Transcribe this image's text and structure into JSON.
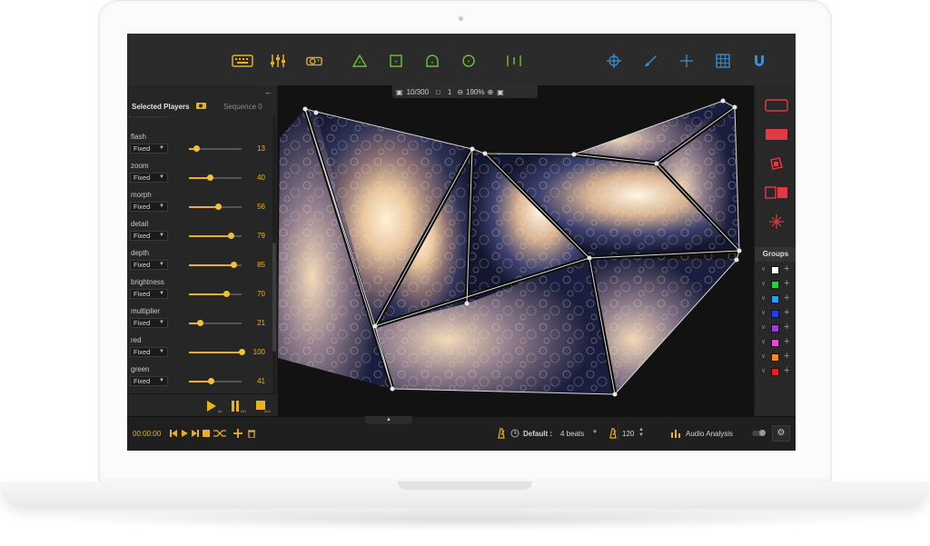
{
  "left_panel": {
    "title": "Selected Players",
    "sequence": "Sequence 0",
    "params": [
      {
        "name": "flash",
        "mode": "Fixed",
        "value": 13
      },
      {
        "name": "zoom",
        "mode": "Fixed",
        "value": 40
      },
      {
        "name": "morph",
        "mode": "Fixed",
        "value": 56
      },
      {
        "name": "detail",
        "mode": "Fixed",
        "value": 79
      },
      {
        "name": "depth",
        "mode": "Fixed",
        "value": 85
      },
      {
        "name": "brightness",
        "mode": "Fixed",
        "value": 70
      },
      {
        "name": "multiplier",
        "mode": "Fixed",
        "value": 21
      },
      {
        "name": "red",
        "mode": "Fixed",
        "value": 100
      },
      {
        "name": "green",
        "mode": "Fixed",
        "value": 41
      }
    ],
    "bottom_buttons": [
      "play-all-icon",
      "pause-all-icon",
      "stop-all-icon"
    ]
  },
  "canvas_bar": {
    "frame": "10/300",
    "count": "1",
    "zoom": "190%"
  },
  "groups": {
    "label": "Groups",
    "colors": [
      "#ffffff",
      "#2ecc40",
      "#2a9df4",
      "#1f3fe0",
      "#9b3fd6",
      "#e64bd1",
      "#f08a1c",
      "#e02424"
    ]
  },
  "bottom_bar": {
    "timecode": "00:00:00",
    "default_label": "Default :",
    "beats": "4 beats",
    "bpm": "120",
    "audio_analysis": "Audio Analysis"
  },
  "colors": {
    "accent": "#e8b21e",
    "toolbar_green": "#6fbf3a",
    "toolbar_blue": "#3a8fd6",
    "tool_red": "#e03a46"
  }
}
